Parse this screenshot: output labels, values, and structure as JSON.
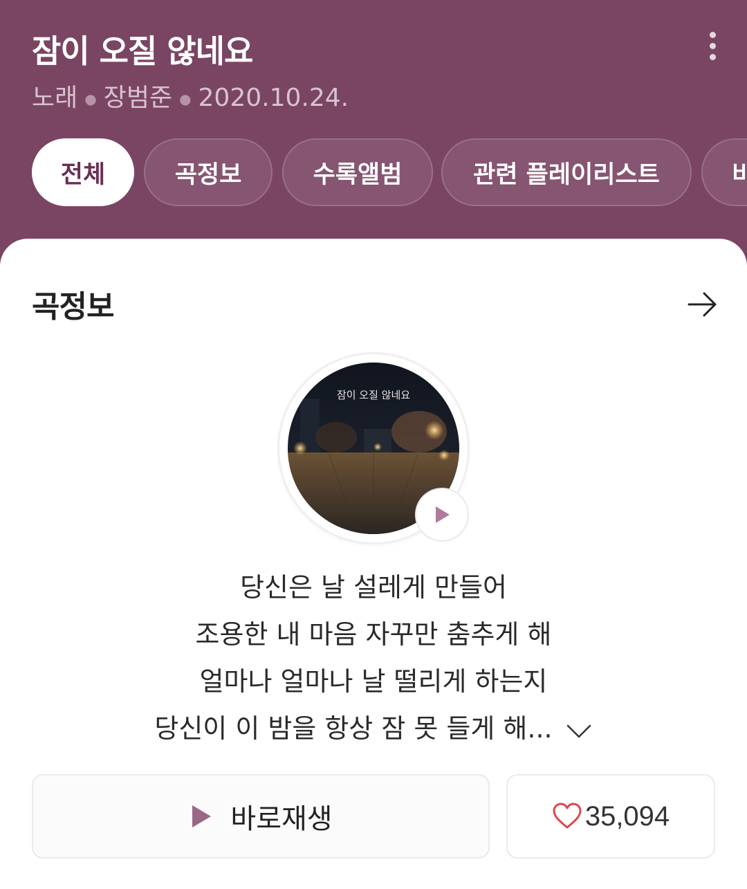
{
  "header": {
    "title": "잠이 오질 않네요",
    "meta": {
      "type": "노래",
      "artist": "장범준",
      "date": "2020.10.24."
    },
    "more_icon": "more-vertical-icon"
  },
  "tabs": [
    {
      "label": "전체",
      "active": true
    },
    {
      "label": "곡정보",
      "active": false
    },
    {
      "label": "수록앨범",
      "active": false
    },
    {
      "label": "관련 플레이리스트",
      "active": false
    },
    {
      "label": "비",
      "active": false
    }
  ],
  "song_info": {
    "section_title": "곡정보",
    "cover_text": "잠이 오질 않네요",
    "lyrics": [
      "당신은 날 설레게 만들어",
      "조용한 내 마음 자꾸만 춤추게 해",
      "얼마나 얼마나 날 떨리게 하는지",
      "당신이 이 밤을 항상 잠 못 들게 해..."
    ],
    "play_button_label": "바로재생",
    "like_count": "35,094"
  },
  "colors": {
    "header_bg": "#7a4563",
    "accent": "#b07a9a",
    "heart": "#e0454f"
  }
}
